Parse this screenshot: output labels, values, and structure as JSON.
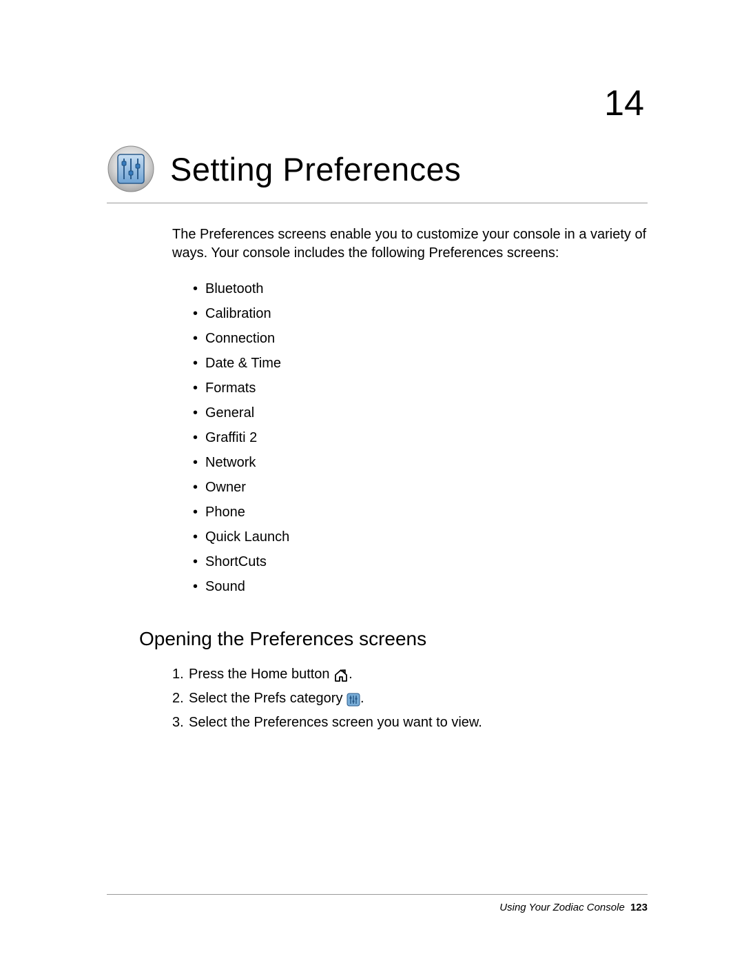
{
  "chapter_number": "14",
  "chapter_title": "Setting Preferences",
  "intro": "The Preferences screens enable you to customize your console in a variety of ways. Your console includes the following Preferences screens:",
  "prefs_list": [
    "Bluetooth",
    "Calibration",
    "Connection",
    "Date & Time",
    "Formats",
    "General",
    "Graffiti 2",
    "Network",
    "Owner",
    "Phone",
    "Quick Launch",
    "ShortCuts",
    "Sound"
  ],
  "section_title": "Opening the Preferences screens",
  "steps": {
    "step1_prefix": "Press the Home button ",
    "step1_suffix": ".",
    "step2_prefix": "Select the Prefs category ",
    "step2_suffix": ".",
    "step3": "Select the Preferences screen you want to view."
  },
  "footer": {
    "title": "Using Your Zodiac Console",
    "page": "123"
  }
}
